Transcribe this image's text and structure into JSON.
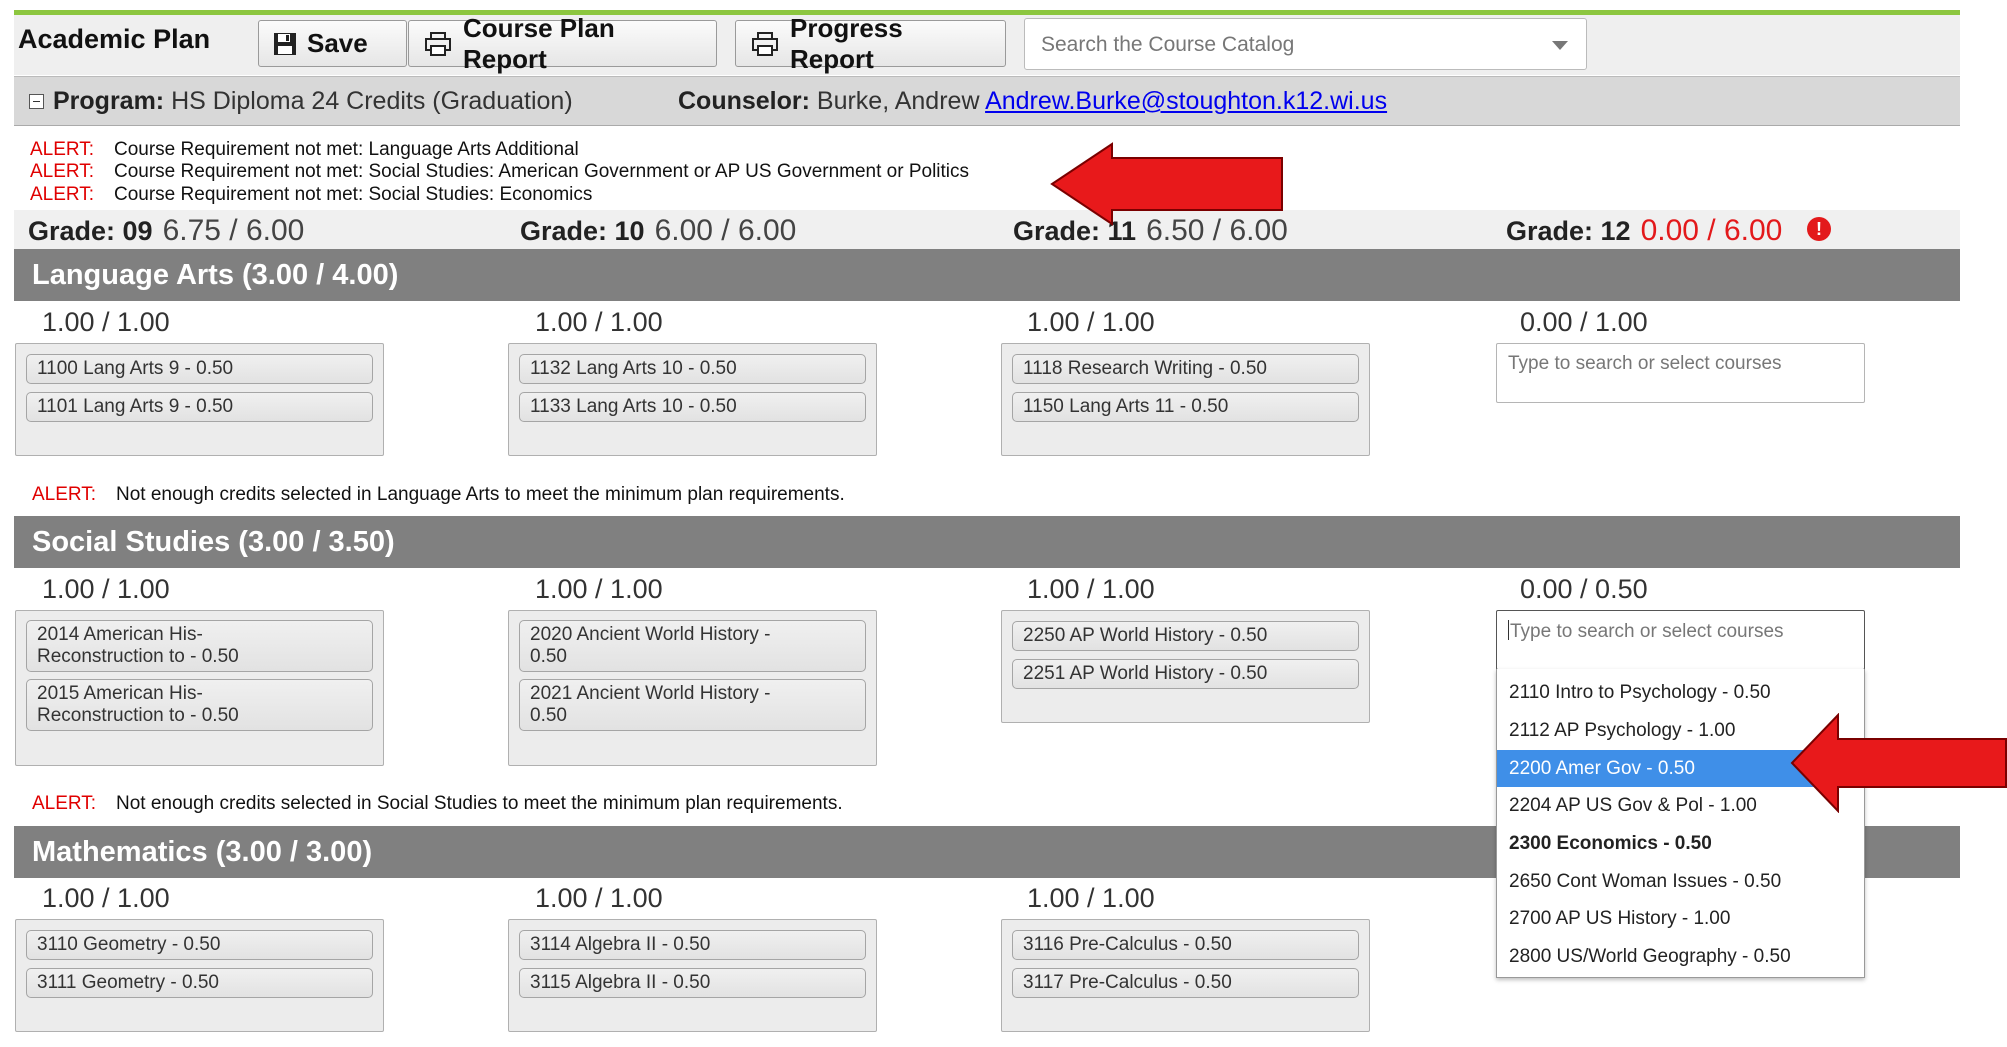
{
  "toolbar": {
    "title": "Academic Plan",
    "save_label": "Save",
    "course_plan_report_label": "Course Plan Report",
    "progress_report_label": "Progress Report",
    "search_placeholder": "Search the Course Catalog"
  },
  "program_bar": {
    "program_label": "Program:",
    "program_value": "HS Diploma 24 Credits (Graduation)",
    "counselor_label": "Counselor:",
    "counselor_name": "Burke, Andrew",
    "counselor_email": "Andrew.Burke@stoughton.k12.wi.us"
  },
  "alerts": [
    {
      "tag": "ALERT:",
      "text": "Course Requirement not met: Language Arts Additional"
    },
    {
      "tag": "ALERT:",
      "text": "Course Requirement not met: Social Studies: American Government or AP US Government or Politics"
    },
    {
      "tag": "ALERT:",
      "text": "Course Requirement not met: Social Studies: Economics"
    }
  ],
  "grades": [
    {
      "label": "Grade: 09",
      "value": "6.75 / 6.00"
    },
    {
      "label": "Grade: 10",
      "value": "6.00 / 6.00"
    },
    {
      "label": "Grade: 11",
      "value": "6.50 / 6.00"
    },
    {
      "label": "Grade: 12",
      "value": "0.00 / 6.00"
    }
  ],
  "warning_glyph": "!",
  "sections": {
    "language_arts": {
      "title": "Language Arts (3.00 / 4.00)",
      "credits": [
        "1.00 / 1.00",
        "1.00 / 1.00",
        "1.00 / 1.00",
        "0.00 / 1.00"
      ],
      "g09": [
        "1100 Lang Arts 9 - 0.50",
        "1101 Lang Arts 9 - 0.50"
      ],
      "g10": [
        "1132 Lang Arts 10 - 0.50",
        "1133 Lang Arts 10 - 0.50"
      ],
      "g11": [
        "1118 Research Writing - 0.50",
        "1150 Lang Arts 11 - 0.50"
      ],
      "g12_placeholder": "Type to search or select courses",
      "alert_tag": "ALERT:",
      "alert_text": "Not enough credits selected in Language Arts to meet the minimum plan requirements."
    },
    "social_studies": {
      "title": "Social Studies (3.00 / 3.50)",
      "credits": [
        "1.00 / 1.00",
        "1.00 / 1.00",
        "1.00 / 1.00",
        "0.00 / 0.50"
      ],
      "g09": [
        "2014 American His-\nReconstruction to - 0.50",
        "2015 American His-\nReconstruction to - 0.50"
      ],
      "g10": [
        "2020 Ancient World History -\n0.50",
        "2021 Ancient World History -\n0.50"
      ],
      "g11": [
        "2250 AP World History - 0.50",
        "2251 AP World History - 0.50"
      ],
      "g12_placeholder": "Type to search or select courses",
      "alert_tag": "ALERT:",
      "alert_text": "Not enough credits selected in Social Studies to meet the minimum plan requirements."
    },
    "mathematics": {
      "title": "Mathematics (3.00 / 3.00)",
      "credits": [
        "1.00 / 1.00",
        "1.00 / 1.00",
        "1.00 / 1.00"
      ],
      "g09": [
        "3110 Geometry - 0.50",
        "3111 Geometry - 0.50"
      ],
      "g10": [
        "3114 Algebra II - 0.50",
        "3115 Algebra II - 0.50"
      ],
      "g11": [
        "3116 Pre-Calculus - 0.50",
        "3117 Pre-Calculus - 0.50"
      ]
    }
  },
  "dropdown": {
    "options": [
      "2110 Intro to Psychology - 0.50",
      "2112 AP Psychology - 1.00",
      "2200 Amer Gov - 0.50",
      "2204 AP US Gov & Pol - 1.00",
      "2300 Economics - 0.50",
      "2650 Cont Woman Issues - 0.50",
      "2700 AP US History - 1.00",
      "2800 US/World Geography - 0.50"
    ],
    "highlighted": "2200 Amer Gov - 0.50",
    "bold": "2300 Economics - 0.50"
  },
  "colors": {
    "accent_green": "#8cc63f",
    "section_header": "#808080",
    "alert_red": "#e00000",
    "highlight_blue": "#3f8fe8",
    "arrow_red": "#e8191b"
  }
}
